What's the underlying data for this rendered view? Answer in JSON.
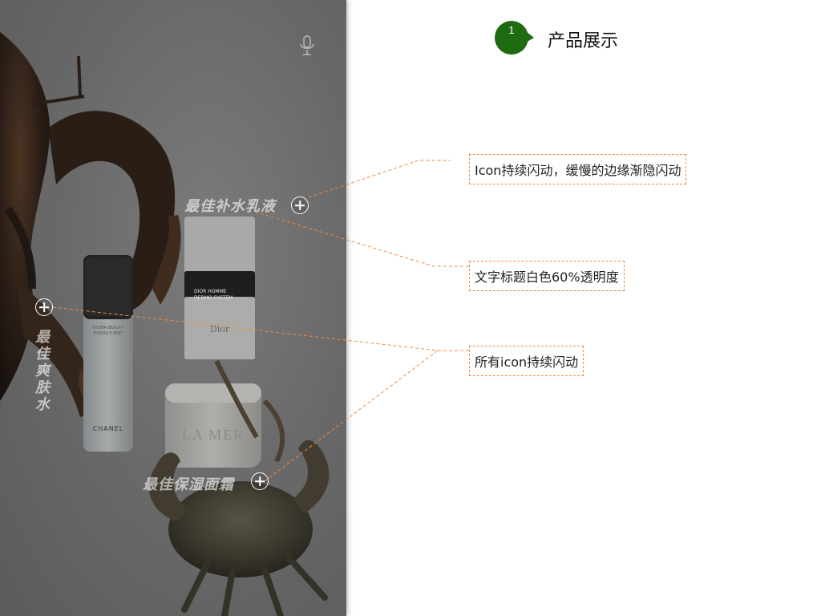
{
  "header": {
    "step_number": "1",
    "title": "产品展示"
  },
  "photo": {
    "titles": {
      "top": "最佳补水乳液",
      "left": "最佳爽肤水",
      "bottom": "最佳保湿面霜"
    },
    "products": {
      "chanel_brand": "CHANEL",
      "chanel_name_1": "HYDRA BEAUTY",
      "chanel_name_2": "ESSENCE MIST",
      "dior_line_1": "DIOR HOMME",
      "dior_line_2": "DERMO SYSTEM",
      "dior_brand": "Dior",
      "lamer_brand": "LA MER"
    }
  },
  "notes": [
    "Icon持续闪动，缓慢的边缘渐隐闪动",
    "文字标题白色60%透明度",
    "所有icon持续闪动"
  ],
  "colors": {
    "badge_green": "#1f6b12",
    "dashed_orange": "#f28a3c",
    "title_white_alpha": "rgba(255,255,255,0.6)"
  },
  "icons": [
    "microphone-icon",
    "plus-circle-icon"
  ]
}
